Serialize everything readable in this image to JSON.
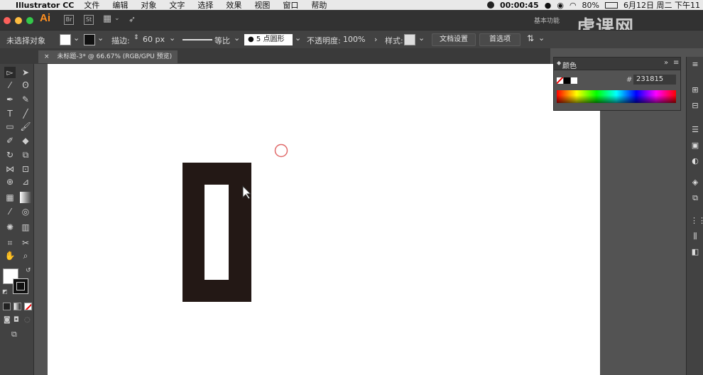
{
  "menubar": {
    "app_name": "Illustrator CC",
    "items": [
      "文件",
      "编辑",
      "对象",
      "文字",
      "选择",
      "效果",
      "视图",
      "窗口",
      "帮助"
    ],
    "timer": "00:00:45",
    "battery": "80%",
    "datetime": "6月12日 周二 下午11"
  },
  "appbar": {
    "logo": "Ai",
    "workspace": "基本功能",
    "watermark": "虎课网"
  },
  "control_bar": {
    "selection_label": "未选择对象",
    "stroke_label": "描边:",
    "stroke_value": "60 px",
    "profile_label": "等比",
    "brush_label": "5 点圆形",
    "opacity_label": "不透明度:",
    "opacity_value": "100%",
    "style_label": "样式:",
    "doc_setup_button": "文档设置",
    "prefs_button": "首选项"
  },
  "document_tab": {
    "close": "×",
    "title": "未标题-3* @ 66.67% (RGB/GPU 预览)"
  },
  "color_panel": {
    "title": "颜色",
    "hex_label": "#",
    "hex_value": "231815"
  },
  "colors": {
    "shape_fill": "#231815",
    "selection_circle": "#e06a6a",
    "ai_orange": "#ff8f1f"
  },
  "icons": [
    "apple-icon",
    "selection-tool-icon",
    "direct-selection-tool-icon",
    "magic-wand-icon",
    "lasso-icon",
    "pen-icon",
    "curvature-icon",
    "type-icon",
    "line-icon",
    "rectangle-icon",
    "paintbrush-icon",
    "shaper-icon",
    "eraser-icon",
    "rotate-icon",
    "scale-icon",
    "width-icon",
    "free-transform-icon",
    "shape-builder-icon",
    "perspective-icon",
    "mesh-icon",
    "gradient-icon",
    "eyedropper-icon",
    "blend-icon",
    "symbol-sprayer-icon",
    "column-graph-icon",
    "artboard-icon",
    "slice-icon",
    "hand-icon",
    "zoom-icon"
  ]
}
